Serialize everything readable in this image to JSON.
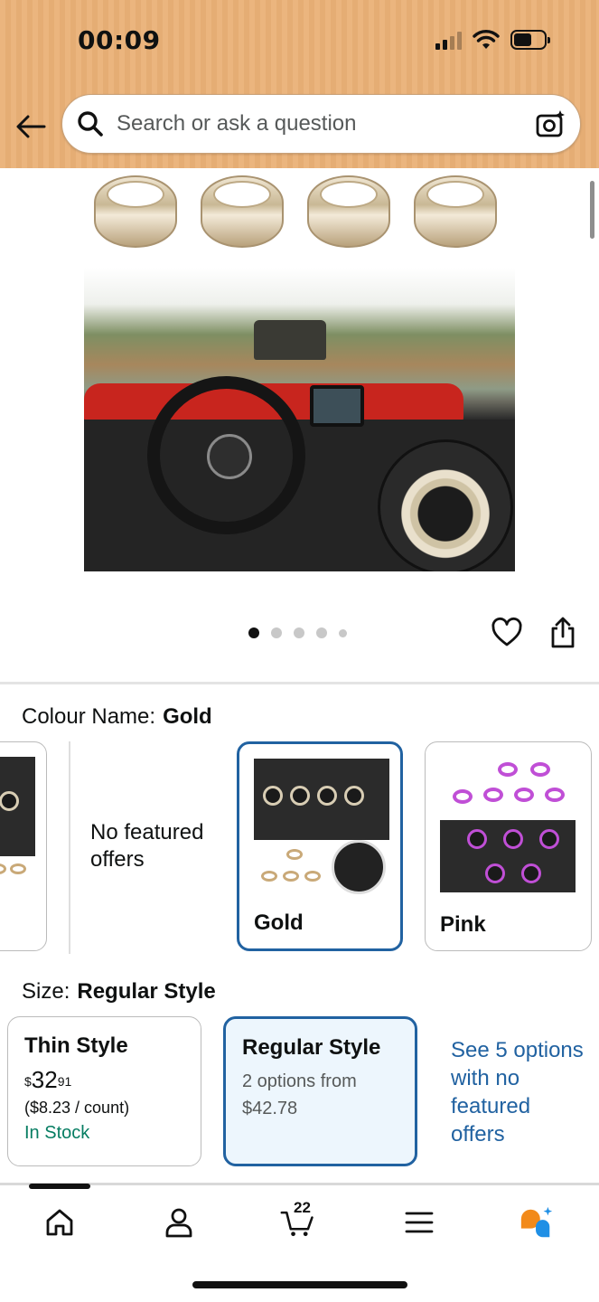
{
  "status_bar": {
    "time": "00:09"
  },
  "header": {
    "search_placeholder": "Search or ask a question"
  },
  "gallery": {
    "image_count": 5,
    "active_index": 0
  },
  "colour": {
    "label": "Colour Name:",
    "selected": "Gold",
    "no_featured_offers": "No featured offers",
    "options": [
      {
        "name": "Gold"
      },
      {
        "name": "Pink"
      }
    ]
  },
  "size": {
    "label": "Size:",
    "selected": "Regular Style",
    "options": [
      {
        "name": "Thin Style",
        "price_currency": "$",
        "price_whole": "32",
        "price_fraction": "91",
        "per_count": "($8.23 / count)",
        "availability": "In Stock"
      },
      {
        "name": "Regular Style",
        "options_from": "2 options from $42.78"
      }
    ],
    "see_more_link": "See 5 options with no featured offers"
  },
  "bottom_nav": {
    "cart_count": "22",
    "items": [
      "home",
      "account",
      "cart",
      "menu",
      "rufus"
    ]
  },
  "colors": {
    "header_bg": "#ebb57e",
    "selected_border": "#2162a1",
    "link": "#2162a1",
    "in_stock": "#067d62"
  }
}
